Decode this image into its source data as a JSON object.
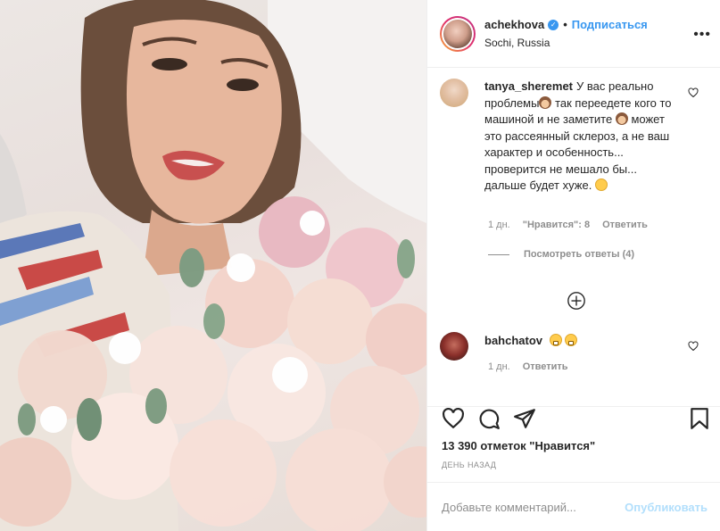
{
  "header": {
    "username": "achekhova",
    "separator": "•",
    "follow_label": "Подписаться",
    "location": "Sochi, Russia"
  },
  "comments": [
    {
      "user": "tanya_sheremet",
      "text_parts": [
        "У вас реально проблемы",
        " так переедете кого то машиной и не заметите ",
        " может это рассеянный склероз, а не ваш характер и особенность... проверится не мешало бы... дальше будет хуже. "
      ],
      "time": "1 дн.",
      "likes": "\"Нравится\": 8",
      "reply": "Ответить",
      "view_replies": "Посмотреть ответы (4)"
    },
    {
      "user": "bahchatov",
      "time": "1 дн.",
      "reply": "Ответить"
    }
  ],
  "likes_text": "13 390 отметок \"Нравится\"",
  "timestamp": "ДЕНЬ НАЗАД",
  "add_comment": {
    "placeholder": "Добавьте комментарий...",
    "publish_label": "Опубликовать"
  },
  "colors": {
    "accent": "#3897f0",
    "publish_disabled": "#b2dffc",
    "muted": "#8e8e8e"
  },
  "icons": [
    "more-icon",
    "verified-icon",
    "heart-icon",
    "comment-icon",
    "share-icon",
    "bookmark-icon",
    "plus-circle-icon"
  ]
}
